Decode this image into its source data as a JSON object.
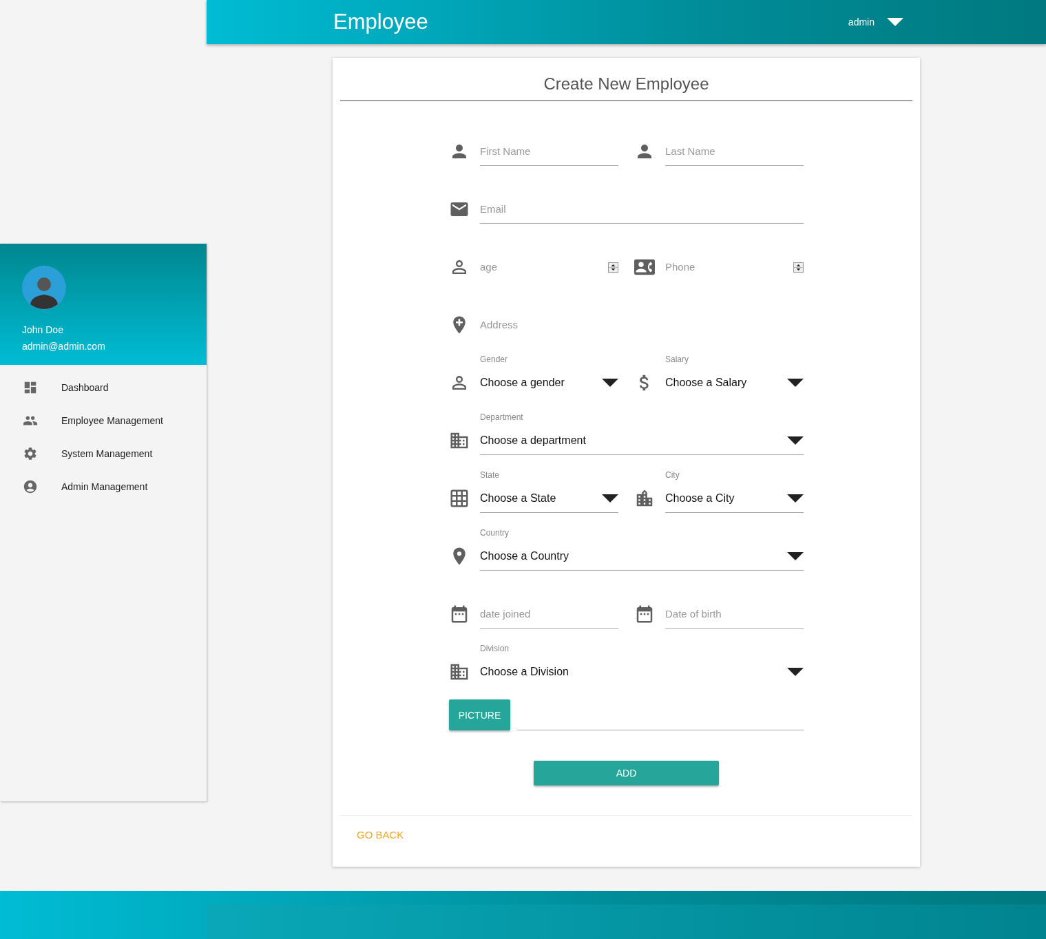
{
  "header": {
    "title": "Employee",
    "user_menu": "admin"
  },
  "sidebar": {
    "profile": {
      "name": "John Doe",
      "email": "admin@admin.com"
    },
    "items": [
      {
        "label": "Dashboard"
      },
      {
        "label": "Employee Management"
      },
      {
        "label": "System Management"
      },
      {
        "label": "Admin Management"
      }
    ]
  },
  "card": {
    "title": "Create New Employee",
    "rows": [
      [
        {
          "kind": "text",
          "placeholder": "First Name",
          "underlined": true
        },
        {
          "kind": "text",
          "placeholder": "Last Name",
          "underlined": true
        }
      ],
      [
        {
          "kind": "text",
          "placeholder": "Email",
          "underlined": true
        }
      ],
      [
        {
          "kind": "number",
          "placeholder": "age",
          "underlined": false
        },
        {
          "kind": "number",
          "placeholder": "Phone",
          "underlined": false
        }
      ],
      [
        {
          "kind": "text",
          "placeholder": "Address",
          "underlined": false
        }
      ],
      [
        {
          "kind": "select",
          "label": "Gender",
          "value": "Choose a gender",
          "underlined": false
        },
        {
          "kind": "select",
          "label": "Salary",
          "value": "Choose a Salary",
          "underlined": false
        }
      ],
      [
        {
          "kind": "select",
          "label": "Department",
          "value": "Choose a department",
          "underlined": true
        }
      ],
      [
        {
          "kind": "select",
          "label": "State",
          "value": "Choose a State",
          "underlined": true
        },
        {
          "kind": "select",
          "label": "City",
          "value": "Choose a City",
          "underlined": true
        }
      ],
      [
        {
          "kind": "select",
          "label": "Country",
          "value": "Choose a Country",
          "underlined": true
        }
      ],
      [
        {
          "kind": "text",
          "placeholder": "date joined",
          "underlined": true
        },
        {
          "kind": "text",
          "placeholder": "Date of birth",
          "underlined": true
        }
      ],
      [
        {
          "kind": "select",
          "label": "Division",
          "value": "Choose a Division",
          "underlined": false
        }
      ]
    ],
    "picture_button": "PICTURE",
    "add_button": "ADD",
    "go_back": "GO BACK"
  }
}
